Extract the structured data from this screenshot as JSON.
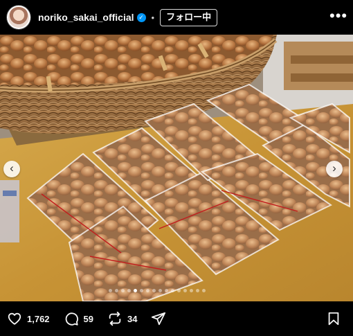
{
  "header": {
    "username": "noriko_sakai_official",
    "verified_icon": "verified-badge-icon",
    "separator": "•",
    "follow_label": "フォロー中",
    "more_icon": "more-options-icon"
  },
  "carousel": {
    "total_slides": 16,
    "active_slide_index": 4,
    "prev_icon": "chevron-left-icon",
    "next_icon": "chevron-right-icon"
  },
  "actions": {
    "likes": "1,762",
    "comments": "59",
    "reposts": "34",
    "like_icon": "heart-icon",
    "comment_icon": "comment-icon",
    "repost_icon": "repost-icon",
    "share_icon": "send-icon",
    "save_icon": "bookmark-icon"
  },
  "colors": {
    "background": "#000000",
    "accent_verified": "#0095f6",
    "text": "#f5f5f5"
  }
}
